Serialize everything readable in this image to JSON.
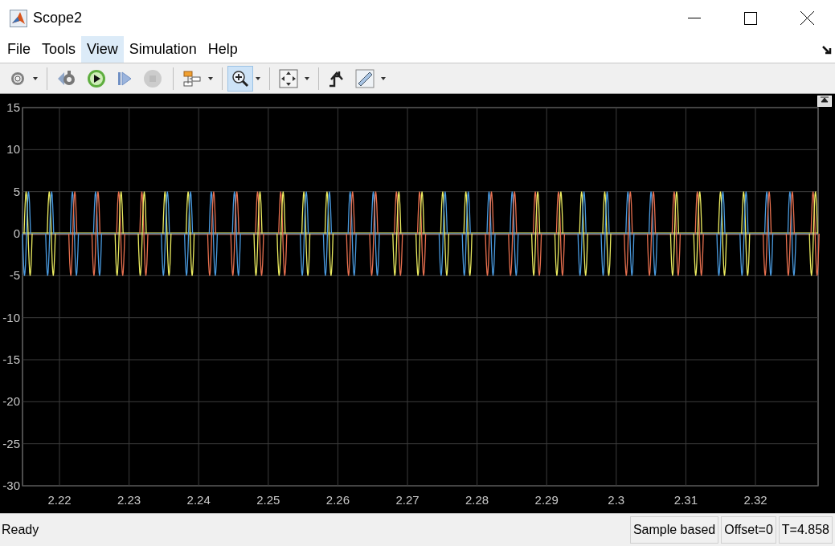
{
  "window": {
    "title": "Scope2"
  },
  "menu": [
    {
      "label": "File",
      "selected": false
    },
    {
      "label": "Tools",
      "selected": false
    },
    {
      "label": "View",
      "selected": true
    },
    {
      "label": "Simulation",
      "selected": false
    },
    {
      "label": "Help",
      "selected": false
    }
  ],
  "toolbar": [
    {
      "kind": "settings",
      "dropdown": true,
      "selected": false,
      "disabled": false
    },
    {
      "kind": "step-back",
      "dropdown": false,
      "selected": false,
      "disabled": false
    },
    {
      "kind": "run",
      "dropdown": false,
      "selected": false,
      "disabled": false
    },
    {
      "kind": "step-forward",
      "dropdown": false,
      "selected": false,
      "disabled": false
    },
    {
      "kind": "stop",
      "dropdown": false,
      "selected": false,
      "disabled": true
    },
    {
      "kind": "highlight",
      "dropdown": true,
      "selected": false,
      "disabled": false
    },
    {
      "kind": "zoom",
      "dropdown": true,
      "selected": true,
      "disabled": false
    },
    {
      "kind": "fit",
      "dropdown": true,
      "selected": false,
      "disabled": false
    },
    {
      "kind": "trigger",
      "dropdown": false,
      "selected": false,
      "disabled": false
    },
    {
      "kind": "measure",
      "dropdown": true,
      "selected": false,
      "disabled": false
    }
  ],
  "plot": {
    "xticks": [
      "2.22",
      "2.23",
      "2.24",
      "2.25",
      "2.26",
      "2.27",
      "2.28",
      "2.29",
      "2.3",
      "2.31",
      "2.32"
    ],
    "yticks": [
      "15",
      "10",
      "5",
      "0",
      "-5",
      "-10",
      "-15",
      "-20",
      "-25",
      "-30"
    ]
  },
  "status_bar": {
    "text": "Ready",
    "fields": [
      "Sample based",
      "Offset=0",
      "T=4.858"
    ]
  }
}
